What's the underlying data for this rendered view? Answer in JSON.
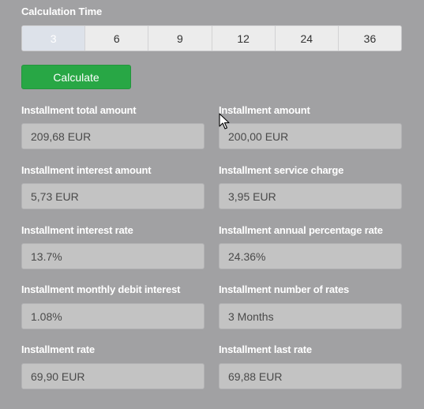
{
  "calculation_time": {
    "label": "Calculation Time",
    "options": [
      "3",
      "6",
      "9",
      "12",
      "24",
      "36"
    ],
    "selected": "3"
  },
  "calculate_button": "Calculate",
  "fields": {
    "total_amount": {
      "label": "Installment total amount",
      "value": "209,68 EUR"
    },
    "amount": {
      "label": "Installment amount",
      "value": "200,00 EUR"
    },
    "interest_amount": {
      "label": "Installment interest amount",
      "value": "5,73 EUR"
    },
    "service_charge": {
      "label": "Installment service charge",
      "value": "3,95 EUR"
    },
    "interest_rate": {
      "label": "Installment interest rate",
      "value": "13.7%"
    },
    "annual_percentage_rate": {
      "label": "Installment annual percentage rate",
      "value": "24.36%"
    },
    "monthly_debit_interest": {
      "label": "Installment monthly debit interest",
      "value": "1.08%"
    },
    "number_of_rates": {
      "label": "Installment number of rates",
      "value": "3 Months"
    },
    "rate": {
      "label": "Installment rate",
      "value": "69,90 EUR"
    },
    "last_rate": {
      "label": "Installment last rate",
      "value": "69,88 EUR"
    }
  },
  "colors": {
    "background": "#a1a1a3",
    "accent_green": "#28a745",
    "field_background": "#c3c3c3"
  },
  "icons": {
    "cursor": "mouse-pointer-icon"
  }
}
